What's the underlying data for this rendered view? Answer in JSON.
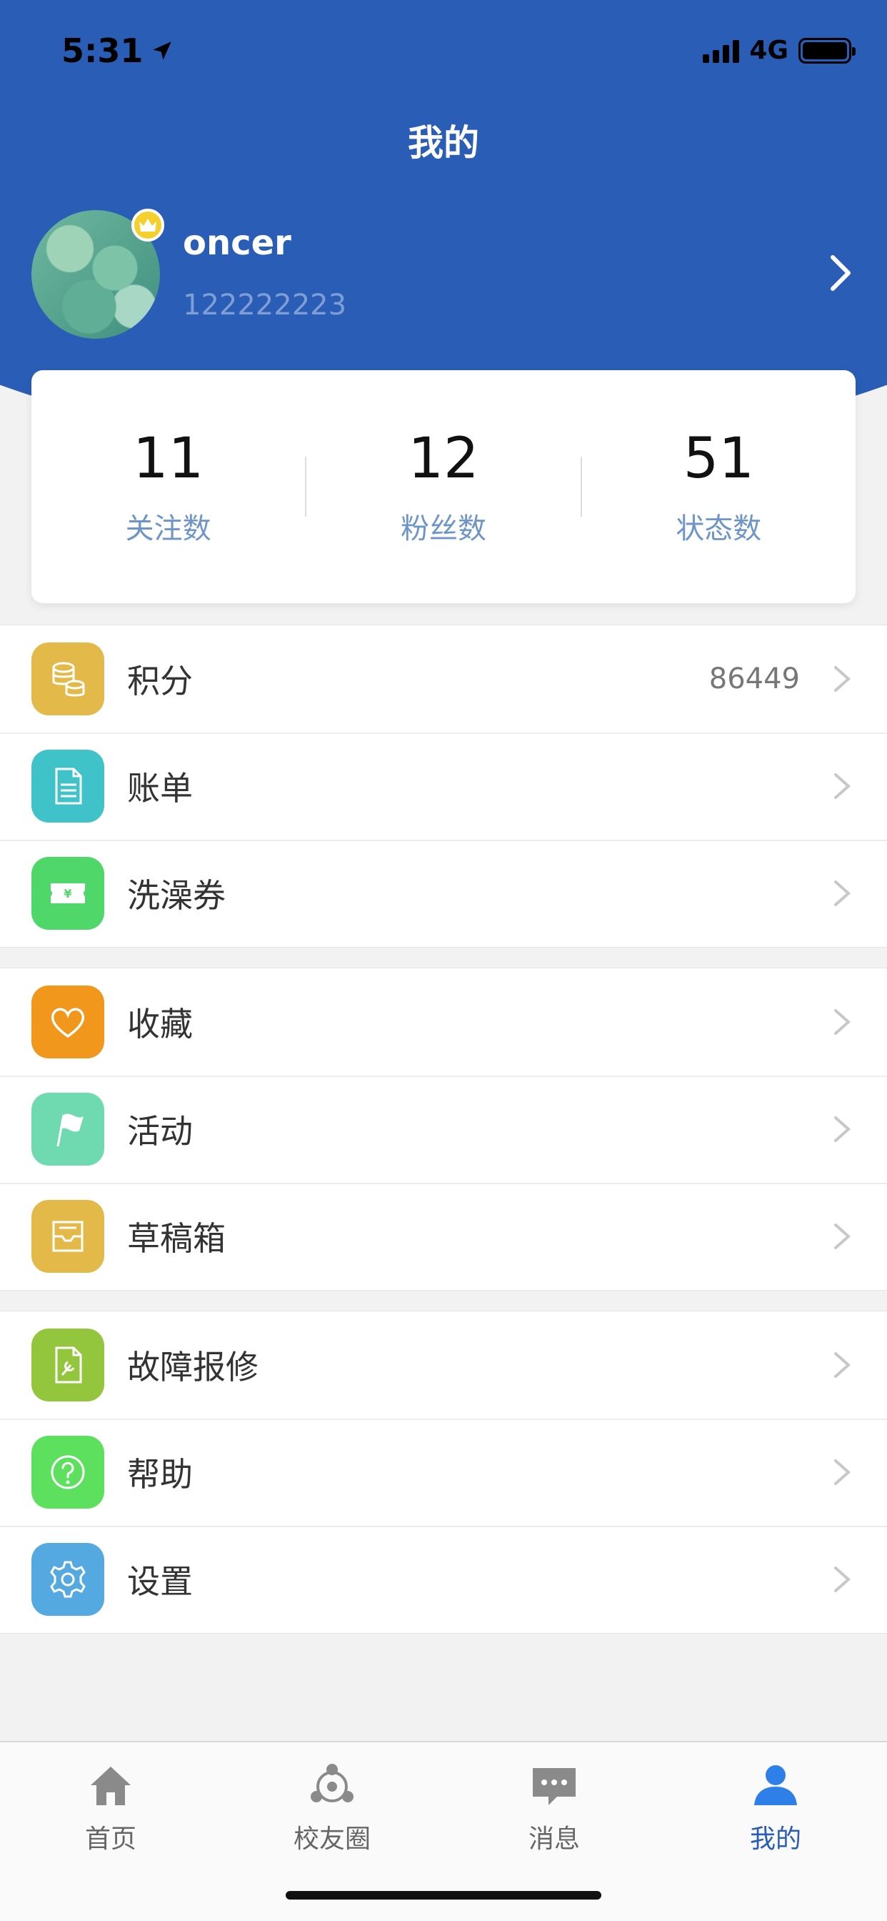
{
  "status_bar": {
    "time": "5:31",
    "network": "4G"
  },
  "header": {
    "title": "我的"
  },
  "profile": {
    "name": "oncer",
    "id": "122222223"
  },
  "stats": [
    {
      "value": "11",
      "label": "关注数"
    },
    {
      "value": "12",
      "label": "粉丝数"
    },
    {
      "value": "51",
      "label": "状态数"
    }
  ],
  "menu": {
    "points": {
      "label": "积分",
      "value": "86449",
      "icon": "coins-icon",
      "color": "#e3b94a"
    },
    "bill": {
      "label": "账单",
      "icon": "document-icon",
      "color": "#3fc3c9"
    },
    "bath": {
      "label": "洗澡券",
      "icon": "ticket-icon",
      "color": "#4fd76a"
    },
    "favorites": {
      "label": "收藏",
      "icon": "heart-icon",
      "color": "#f0971c"
    },
    "activities": {
      "label": "活动",
      "icon": "flag-icon",
      "color": "#6fdab0"
    },
    "drafts": {
      "label": "草稿箱",
      "icon": "tray-icon",
      "color": "#e3b94a"
    },
    "repair": {
      "label": "故障报修",
      "icon": "wrench-doc-icon",
      "color": "#93c63c"
    },
    "help": {
      "label": "帮助",
      "icon": "help-icon",
      "color": "#5ee05f"
    },
    "settings": {
      "label": "设置",
      "icon": "gear-icon",
      "color": "#53a9e0"
    }
  },
  "tabs": [
    {
      "label": "首页",
      "icon": "home-icon"
    },
    {
      "label": "校友圈",
      "icon": "community-icon"
    },
    {
      "label": "消息",
      "icon": "message-icon"
    },
    {
      "label": "我的",
      "icon": "user-icon",
      "active": true
    }
  ]
}
